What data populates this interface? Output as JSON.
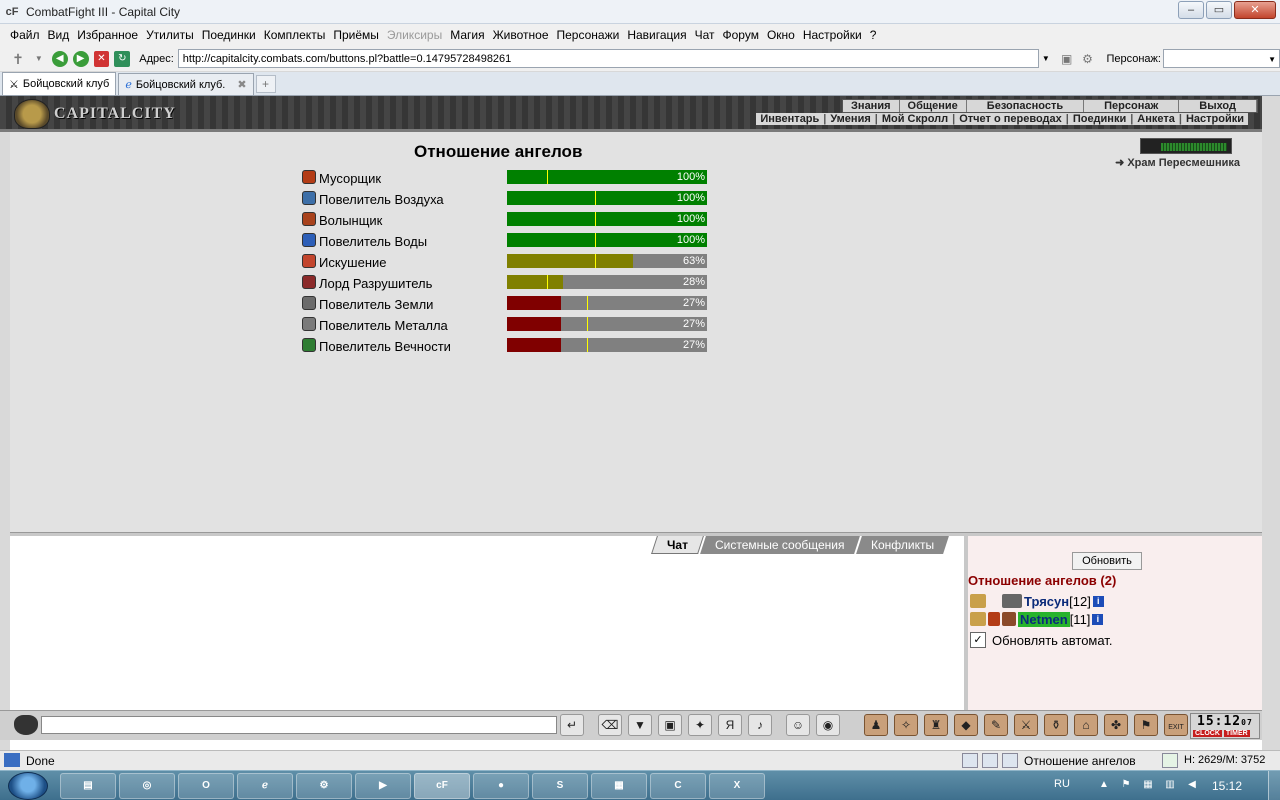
{
  "window": {
    "title": "CombatFight III - Capital City",
    "icon_text": "cF",
    "controls": [
      "–",
      "▭",
      "✕"
    ]
  },
  "menu": [
    {
      "label": "Файл",
      "disabled": false
    },
    {
      "label": "Вид",
      "disabled": false
    },
    {
      "label": "Избранное",
      "disabled": false
    },
    {
      "label": "Утилиты",
      "disabled": false
    },
    {
      "label": "Поединки",
      "disabled": false
    },
    {
      "label": "Комплекты",
      "disabled": false
    },
    {
      "label": "Приёмы",
      "disabled": false
    },
    {
      "label": "Эликсиры",
      "disabled": true
    },
    {
      "label": "Магия",
      "disabled": false
    },
    {
      "label": "Животное",
      "disabled": false
    },
    {
      "label": "Персонажи",
      "disabled": false
    },
    {
      "label": "Навигация",
      "disabled": false
    },
    {
      "label": "Чат",
      "disabled": false
    },
    {
      "label": "Форум",
      "disabled": false
    },
    {
      "label": "Окно",
      "disabled": false
    },
    {
      "label": "Настройки",
      "disabled": false
    },
    {
      "label": "?",
      "disabled": false
    }
  ],
  "address": {
    "label": "Адрес:",
    "url": "http://capitalcity.combats.com/buttons.pl?battle=0.14795728498261",
    "person_label": "Персонаж:",
    "person_value": ""
  },
  "tabs": [
    {
      "label": "Бойцовский клуб",
      "active": true
    },
    {
      "label": "Бойцовский клуб.",
      "active": false
    }
  ],
  "game_header": {
    "logo_text": "CAPITALCITY",
    "nav_top": [
      "Знания",
      "Общение",
      "Безопасность",
      "Персонаж",
      "Выход"
    ],
    "nav_bottom": [
      "Инвентарь",
      "Умения",
      "Мой Скролл",
      "Отчет о переводах",
      "Поединки",
      "Анкета",
      "Настройки"
    ]
  },
  "panel": {
    "title": "Отношение ангелов",
    "temple_link": "Храм Пересмешника"
  },
  "angels": [
    {
      "name": "Мусорщик",
      "percent": 100,
      "percent_label": "100%",
      "color": "#008000",
      "icon_color": "#b33c16",
      "mark": 0.2
    },
    {
      "name": "Повелитель Воздуха",
      "percent": 100,
      "percent_label": "100%",
      "color": "#008000",
      "icon_color": "#3d6fa8",
      "mark": 0.44
    },
    {
      "name": "Волынщик",
      "percent": 100,
      "percent_label": "100%",
      "color": "#008000",
      "icon_color": "#a8421c",
      "mark": 0.44
    },
    {
      "name": "Повелитель Воды",
      "percent": 100,
      "percent_label": "100%",
      "color": "#008000",
      "icon_color": "#2d5fb8",
      "mark": 0.44
    },
    {
      "name": "Искушение",
      "percent": 63,
      "percent_label": "63%",
      "color": "#808000",
      "icon_color": "#c2452d",
      "mark": 0.44
    },
    {
      "name": "Лорд Разрушитель",
      "percent": 28,
      "percent_label": "28%",
      "color": "#808000",
      "icon_color": "#8b2a2a",
      "mark": 0.2
    },
    {
      "name": "Повелитель Земли",
      "percent": 27,
      "percent_label": "27%",
      "color": "#800000",
      "icon_color": "#6b6b6b",
      "mark": 0.4
    },
    {
      "name": "Повелитель Металла",
      "percent": 27,
      "percent_label": "27%",
      "color": "#800000",
      "icon_color": "#7a7a7a",
      "mark": 0.4
    },
    {
      "name": "Повелитель Вечности",
      "percent": 27,
      "percent_label": "27%",
      "color": "#800000",
      "icon_color": "#2e7d32",
      "mark": 0.4
    }
  ],
  "chat": {
    "tabs": [
      {
        "label": "Чат",
        "active": true
      },
      {
        "label": "Системные сообщения",
        "active": false
      },
      {
        "label": "Конфликты",
        "active": false
      }
    ]
  },
  "online": {
    "refresh_label": "Обновить",
    "title": "Отношение ангелов (2)",
    "users": [
      {
        "name": "Трясун",
        "level": "[12]",
        "highlight": false
      },
      {
        "name": "Netmen",
        "level": "[11]",
        "highlight": true
      }
    ],
    "auto_label": "Обновлять автомат.",
    "auto_checked": true
  },
  "toolbar": {
    "clock_time": "15:12",
    "clock_sec": "07",
    "clock_label": "CLOCK",
    "timer_label": "TIMER",
    "exit_label": "EXIT"
  },
  "status": {
    "text": "Done",
    "page": "Отношение ангелов",
    "hm": "H: 2629/M: 3752"
  },
  "taskbar": {
    "lang": "RU",
    "time": "15:12",
    "apps": [
      "explorer",
      "chrome",
      "outlook",
      "ie",
      "program",
      "media",
      "cf",
      "messenger",
      "skype",
      "calendar",
      "cc",
      "excel"
    ]
  }
}
